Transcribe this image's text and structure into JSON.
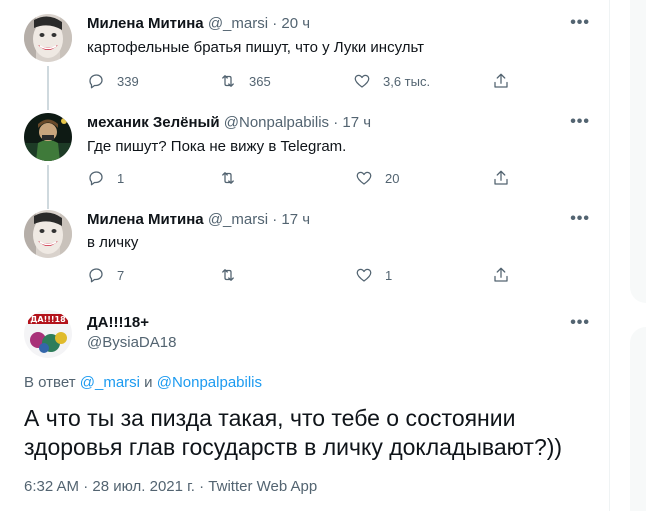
{
  "tweets": [
    {
      "name": "Милена Митина",
      "handle": "@_marsi",
      "dot": "·",
      "time": "20 ч",
      "text": "картофельные братья пишут, что у Луки инсульт",
      "counts": {
        "reply": "339",
        "retweet": "365",
        "like": "3,6 тыс."
      }
    },
    {
      "name": "механик Зелёный",
      "handle": "@Nonpalpabilis",
      "dot": "·",
      "time": "17 ч",
      "text": "Где пишут? Пока не вижу в Telegram.",
      "counts": {
        "reply": "1",
        "retweet": "",
        "like": "20"
      }
    },
    {
      "name": "Милена Митина",
      "handle": "@_marsi",
      "dot": "·",
      "time": "17 ч",
      "text": "в личку",
      "counts": {
        "reply": "7",
        "retweet": "",
        "like": "1"
      }
    }
  ],
  "main_tweet": {
    "name": "ДА!!!18+",
    "handle": "@BysiaDA18",
    "avatar_text": "ДА!!!18",
    "reply_prefix": "В ответ",
    "reply_user1": "@_marsi",
    "reply_and": "и",
    "reply_user2": "@Nonpalpabilis",
    "text": "А что ты за пизда такая, что тебе о состоянии здоровья глав государств  в личку докладывают?))",
    "meta": "6:32 AM · 28 июл. 2021 г. · Twitter Web App"
  },
  "more_label": "•••",
  "colors": {
    "link": "#1d9bf0",
    "secondary": "#536471",
    "primary": "#0f1419"
  }
}
